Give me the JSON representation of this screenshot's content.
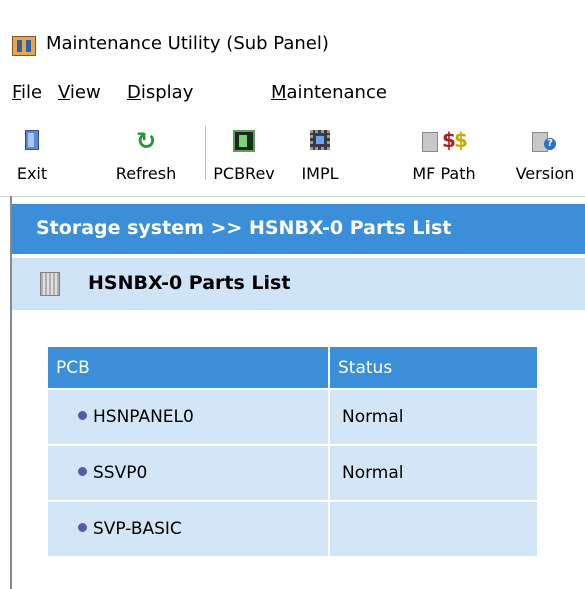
{
  "window": {
    "title": "Maintenance Utility (Sub Panel)"
  },
  "menu": [
    {
      "label": "File",
      "accel": "F",
      "rest": "ile"
    },
    {
      "label": "View",
      "accel": "V",
      "rest": "iew"
    },
    {
      "label": "Display",
      "accel": "D",
      "rest": "isplay"
    },
    {
      "label": "Maintenance",
      "accel": "M",
      "rest": "aintenance"
    }
  ],
  "toolbar": {
    "exit": {
      "label": "Exit",
      "icon": "exit-icon"
    },
    "refresh": {
      "label": "Refresh",
      "icon": "refresh-icon"
    },
    "pcbrev": {
      "label": "PCBRev",
      "icon": "pcb-board-icon"
    },
    "impl": {
      "label": "IMPL",
      "icon": "chip-icon"
    },
    "mfpath": {
      "label": "MF Path",
      "icon": "mf-path-icon"
    },
    "version": {
      "label": "Version",
      "icon": "version-info-icon"
    }
  },
  "breadcrumb": {
    "text": "Storage system >> HSNBX-0 Parts List"
  },
  "section": {
    "title": "HSNBX-0 Parts List",
    "icon": "hardware-box-icon"
  },
  "table": {
    "headers": {
      "pcb": "PCB",
      "status": "Status"
    },
    "rows": [
      {
        "pcb": "HSNPANEL0",
        "status": "Normal"
      },
      {
        "pcb": "SSVP0",
        "status": "Normal"
      },
      {
        "pcb": "SVP-BASIC",
        "status": ""
      }
    ]
  },
  "colors": {
    "accent_blue": "#3b8fd9",
    "section_bg": "#cfe4f7",
    "row_bg": "#d3e6f8"
  }
}
